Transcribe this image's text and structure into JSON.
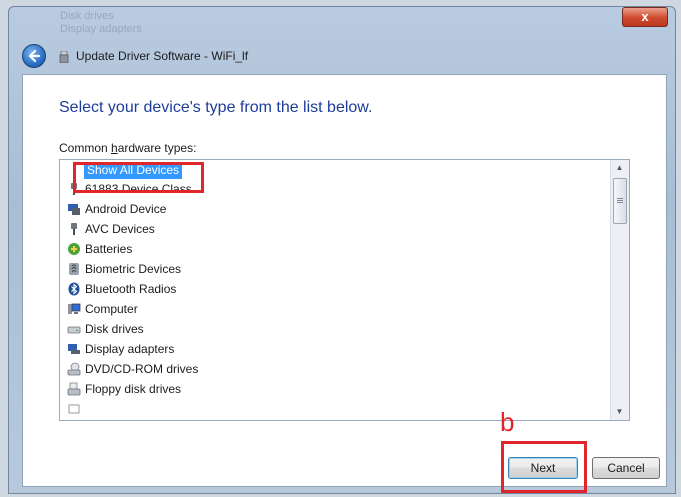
{
  "window": {
    "title": "Update Driver Software - WiFi_lf",
    "close_label": "x",
    "background_items": [
      "Disk drives",
      "Display adapters"
    ]
  },
  "main": {
    "heading": "Select your device's type from the list below.",
    "list_label": "Common hardware types:",
    "selected_item": "Show All Devices",
    "items": [
      {
        "label": "Show All Devices",
        "icon": "none",
        "selected": true
      },
      {
        "label": "61883 Device Class",
        "icon": "plug-icon"
      },
      {
        "label": "Android Device",
        "icon": "android-device-icon"
      },
      {
        "label": "AVC Devices",
        "icon": "plug-icon"
      },
      {
        "label": "Batteries",
        "icon": "battery-icon"
      },
      {
        "label": "Biometric Devices",
        "icon": "biometric-icon"
      },
      {
        "label": "Bluetooth Radios",
        "icon": "bluetooth-icon"
      },
      {
        "label": "Computer",
        "icon": "computer-icon"
      },
      {
        "label": "Disk drives",
        "icon": "disk-drive-icon"
      },
      {
        "label": "Display adapters",
        "icon": "display-adapter-icon"
      },
      {
        "label": "DVD/CD-ROM drives",
        "icon": "dvd-drive-icon"
      },
      {
        "label": "Floppy disk drives",
        "icon": "floppy-drive-icon"
      }
    ]
  },
  "footer": {
    "next_label": "Next",
    "cancel_label": "Cancel"
  },
  "annotation": {
    "label": "b",
    "color": "#e0262d"
  },
  "colors": {
    "heading": "#1e3d9a",
    "selection": "#3399ff",
    "annotation": "#e0262d"
  }
}
